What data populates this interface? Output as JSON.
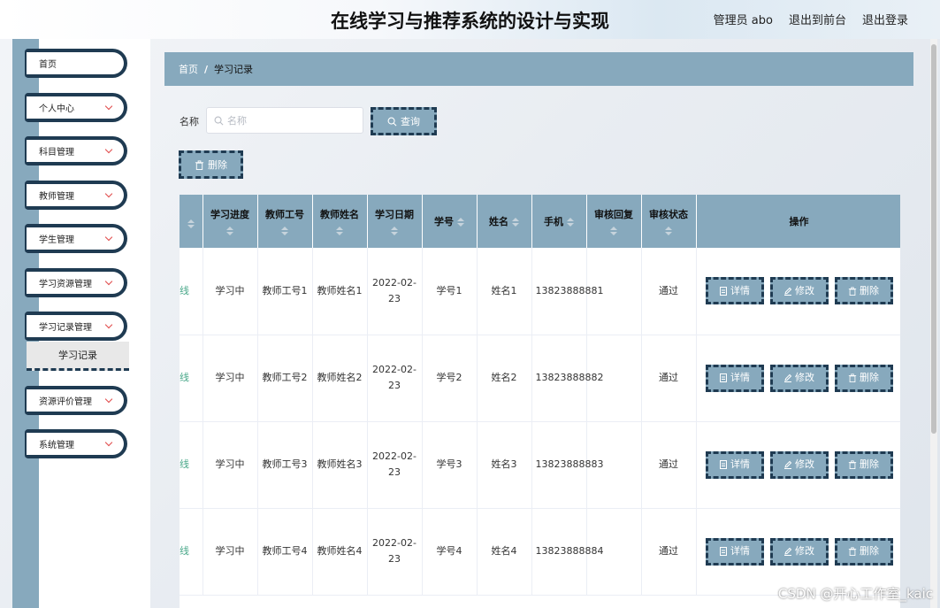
{
  "header": {
    "title": "在线学习与推荐系统的设计与实现",
    "admin_label": "管理员 abo",
    "front_link": "退出到前台",
    "logout_link": "退出登录"
  },
  "sidebar": {
    "items": [
      {
        "label": "首页",
        "has_arrow": false
      },
      {
        "label": "个人中心",
        "has_arrow": true
      },
      {
        "label": "科目管理",
        "has_arrow": true
      },
      {
        "label": "教师管理",
        "has_arrow": true
      },
      {
        "label": "学生管理",
        "has_arrow": true
      },
      {
        "label": "学习资源管理",
        "has_arrow": true
      },
      {
        "label": "学习记录管理",
        "has_arrow": true
      },
      {
        "label": "资源评价管理",
        "has_arrow": true
      },
      {
        "label": "系统管理",
        "has_arrow": true
      }
    ],
    "active_sub": "学习记录"
  },
  "breadcrumb": {
    "home": "首页",
    "separator": "/",
    "current": "学习记录"
  },
  "search": {
    "label": "名称",
    "placeholder": "名称",
    "button": "查询"
  },
  "toolbar": {
    "delete_label": "删除"
  },
  "table": {
    "columns": [
      "学习进度",
      "教师工号",
      "教师姓名",
      "学习日期",
      "学号",
      "姓名",
      "手机",
      "审核回复",
      "审核状态",
      "操作"
    ],
    "truncated_text": "线",
    "rows": [
      {
        "progress": "学习中",
        "teacher_id": "教师工号1",
        "teacher_name": "教师姓名1",
        "date": "2022-02-23",
        "student_no": "学号1",
        "name": "姓名1",
        "phone": "13823888881",
        "reply": "",
        "status": "通过"
      },
      {
        "progress": "学习中",
        "teacher_id": "教师工号2",
        "teacher_name": "教师姓名2",
        "date": "2022-02-23",
        "student_no": "学号2",
        "name": "姓名2",
        "phone": "13823888882",
        "reply": "",
        "status": "通过"
      },
      {
        "progress": "学习中",
        "teacher_id": "教师工号3",
        "teacher_name": "教师姓名3",
        "date": "2022-02-23",
        "student_no": "学号3",
        "name": "姓名3",
        "phone": "13823888883",
        "reply": "",
        "status": "通过"
      },
      {
        "progress": "学习中",
        "teacher_id": "教师工号4",
        "teacher_name": "教师姓名4",
        "date": "2022-02-23",
        "student_no": "学号4",
        "name": "姓名4",
        "phone": "13823888884",
        "reply": "",
        "status": "通过"
      }
    ],
    "actions": {
      "detail": "详情",
      "edit": "修改",
      "delete": "删除"
    }
  },
  "watermark": "CSDN @开心工作室_kaic",
  "colors": {
    "accent": "#87a9bd",
    "border_dark": "#1f3b52",
    "link_green": "#4aa88a"
  },
  "icons": [
    "search-icon",
    "trash-icon",
    "document-icon",
    "pencil-icon",
    "chevron-down-icon",
    "sort-icon"
  ]
}
